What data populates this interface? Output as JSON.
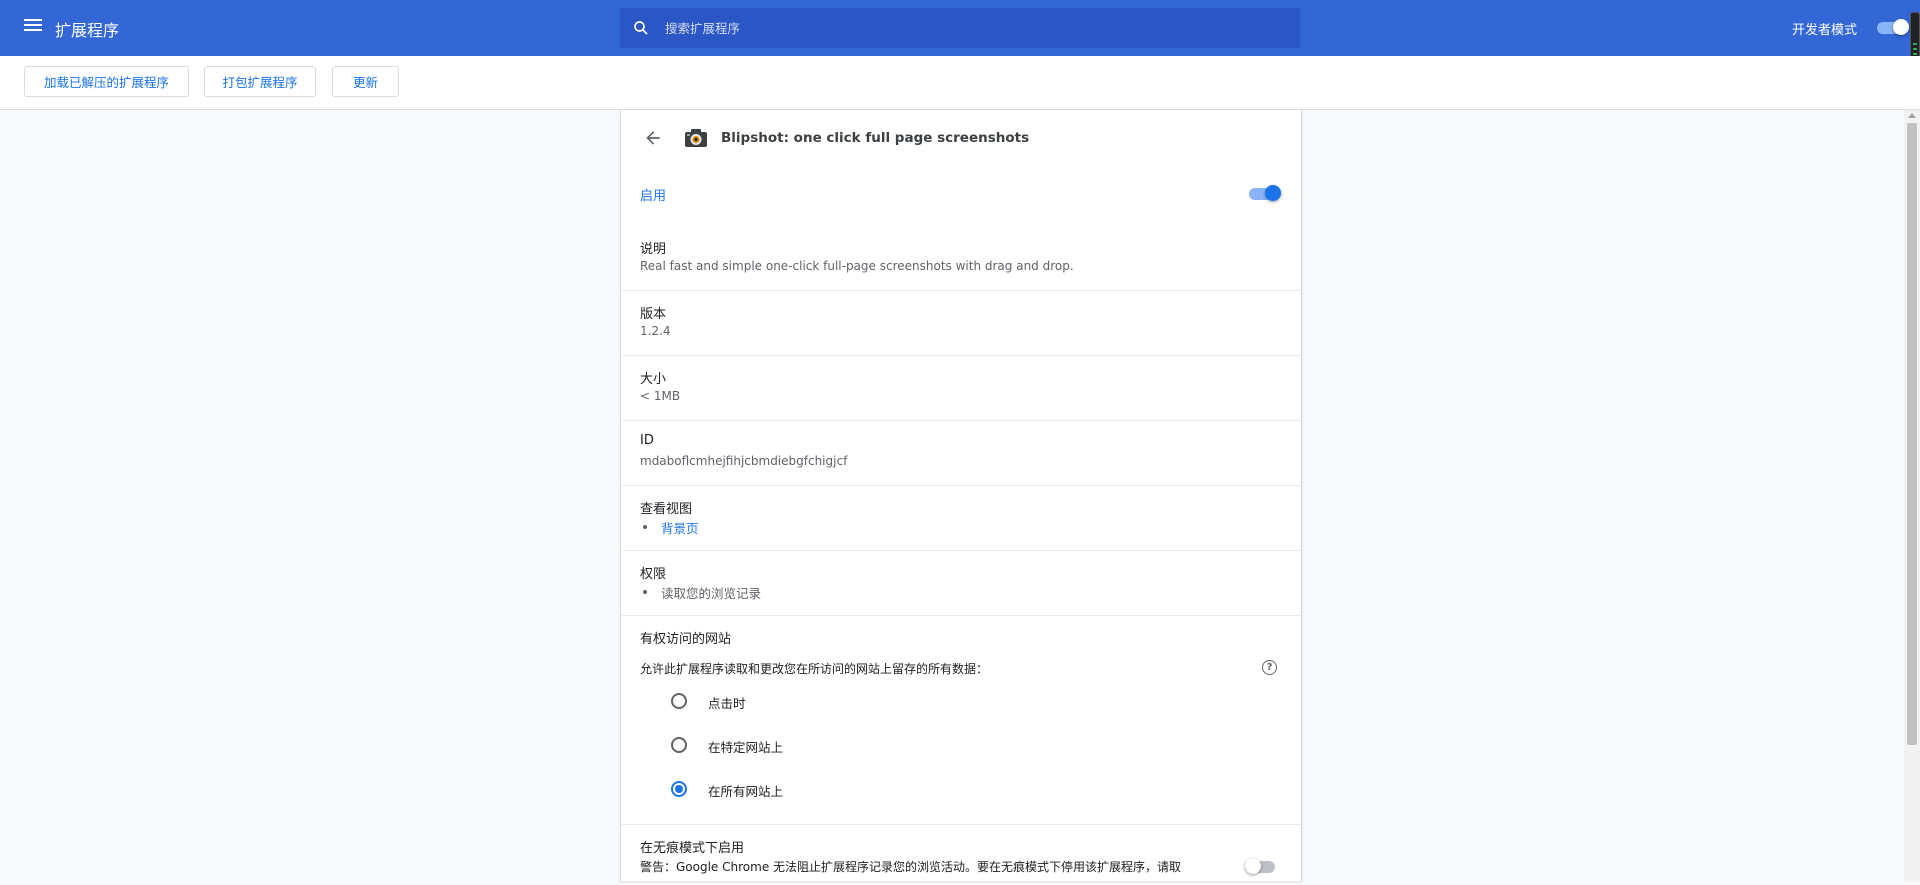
{
  "header": {
    "title": "扩展程序",
    "search_placeholder": "搜索扩展程序",
    "dev_mode_label": "开发者模式",
    "dev_mode_on": true
  },
  "toolbar": {
    "load_unpacked": "加载已解压的扩展程序",
    "pack": "打包扩展程序",
    "update": "更新"
  },
  "extension": {
    "name": "Blipshot: one click full page screenshots",
    "enabled_label": "启用",
    "enabled": true,
    "description_label": "说明",
    "description": "Real fast and simple one-click full-page screenshots with drag and drop.",
    "version_label": "版本",
    "version": "1.2.4",
    "size_label": "大小",
    "size": "< 1MB",
    "id_label": "ID",
    "id": "mdaboflcmhejfihjcbmdiebgfchigjcf",
    "views_label": "查看视图",
    "views": [
      "背景页"
    ],
    "permissions_label": "权限",
    "permissions": [
      "读取您的浏览记录"
    ],
    "site_access_label": "有权访问的网站",
    "site_access_desc": "允许此扩展程序读取和更改您在所访问的网站上留存的所有数据：",
    "site_access_options": [
      "点击时",
      "在特定网站上",
      "在所有网站上"
    ],
    "site_access_selected": "在所有网站上",
    "incognito_label": "在无痕模式下启用",
    "incognito_warning": "警告：Google Chrome 无法阻止扩展程序记录您的浏览活动。要在无痕模式下停用该扩展程序，请取",
    "incognito_enabled": false
  },
  "colors": {
    "header_bg": "#3367d6",
    "accent": "#1a73e8",
    "page_bg": "#f8f9fa"
  },
  "icons": {
    "menu": "hamburger-menu-icon",
    "search": "search-icon",
    "back": "back-arrow-icon",
    "extension": "camera-icon",
    "help": "help-icon"
  }
}
